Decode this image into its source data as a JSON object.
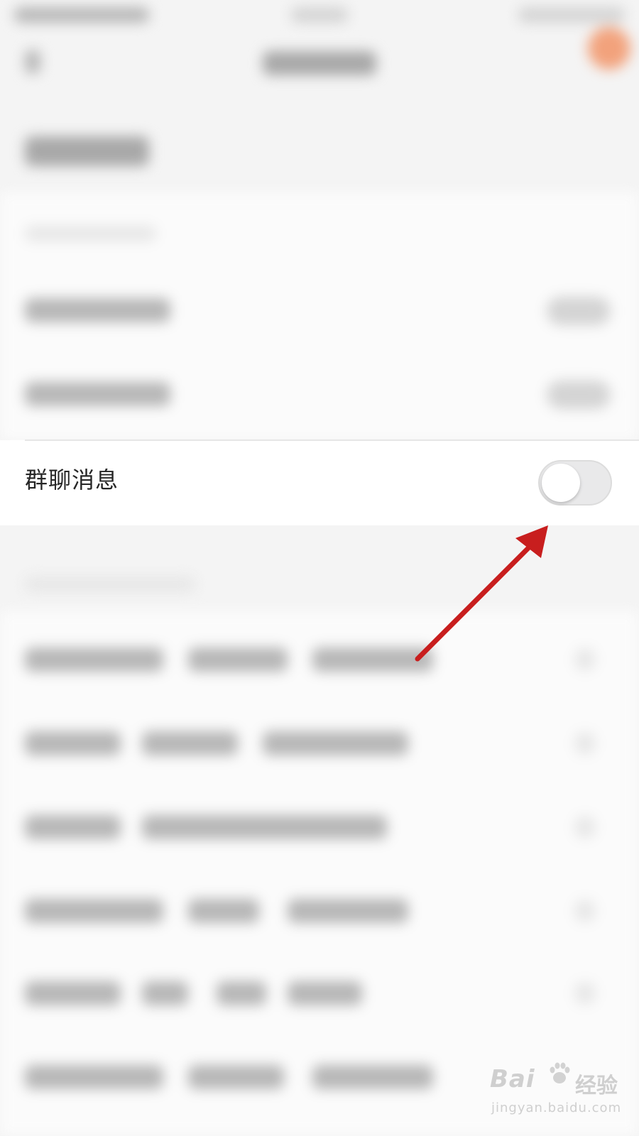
{
  "focused_row": {
    "label": "群聊消息",
    "toggle_on": false
  },
  "watermark": {
    "logo_text": "Bai",
    "logo_suffix": "du",
    "brand": "经验",
    "url": "jingyan.baidu.com"
  },
  "colors": {
    "annotation_arrow": "#c81e1e",
    "toggle_off_track": "#e9e9ea",
    "avatar_accent": "#f2a27c"
  }
}
